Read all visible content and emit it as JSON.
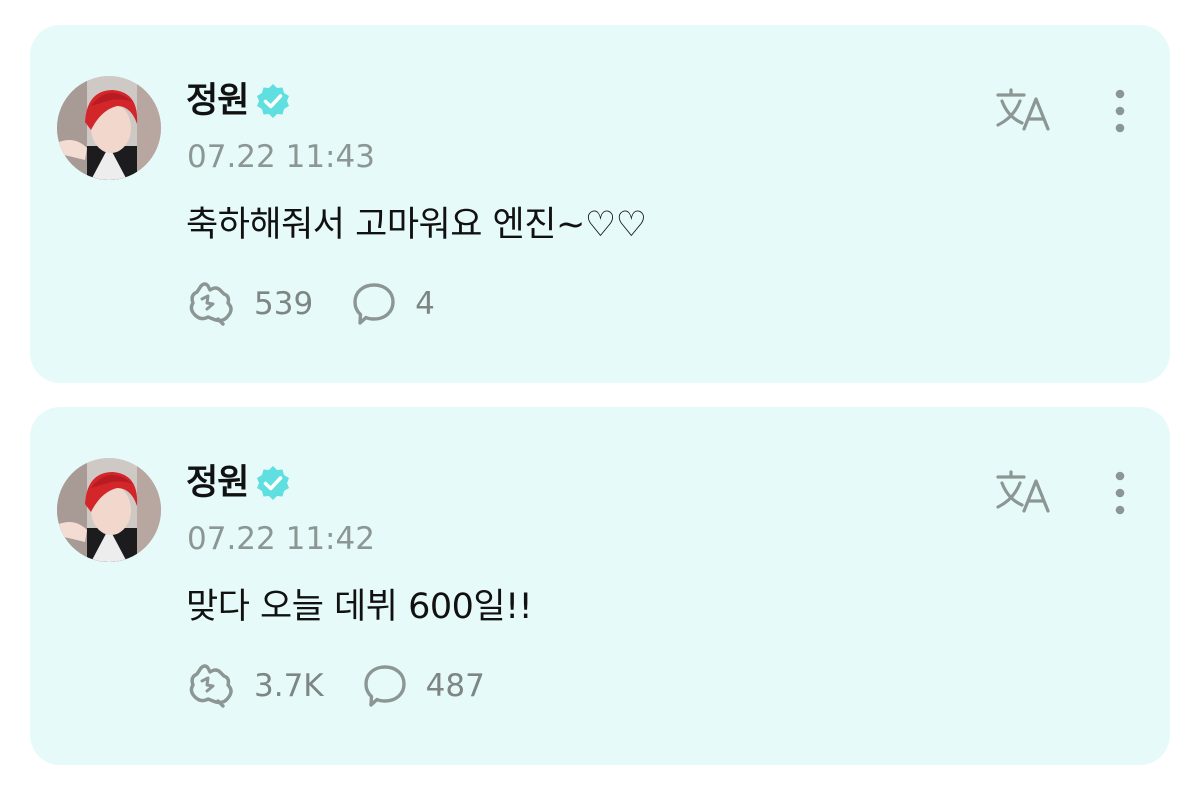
{
  "posts": [
    {
      "author": "정원",
      "timestamp": "07.22 11:43",
      "text": "축하해줘서 고마워요 엔진~♡♡",
      "likes": "539",
      "comments": "4"
    },
    {
      "author": "정원",
      "timestamp": "07.22 11:42",
      "text": "맞다 오늘 데뷔 600일!!",
      "likes": "3.7K",
      "comments": "487"
    }
  ],
  "icons": {
    "verified": "verified-badge-icon",
    "translate": "translate-icon",
    "more": "more-vertical-icon",
    "like": "cheer-hand-icon",
    "comment": "comment-bubble-icon"
  },
  "colors": {
    "card_background": "#e6fbf9",
    "verified_badge": "#5fdfe0",
    "icon_gray": "#8c9694",
    "text": "#111111",
    "meta_text": "#8c9694"
  }
}
